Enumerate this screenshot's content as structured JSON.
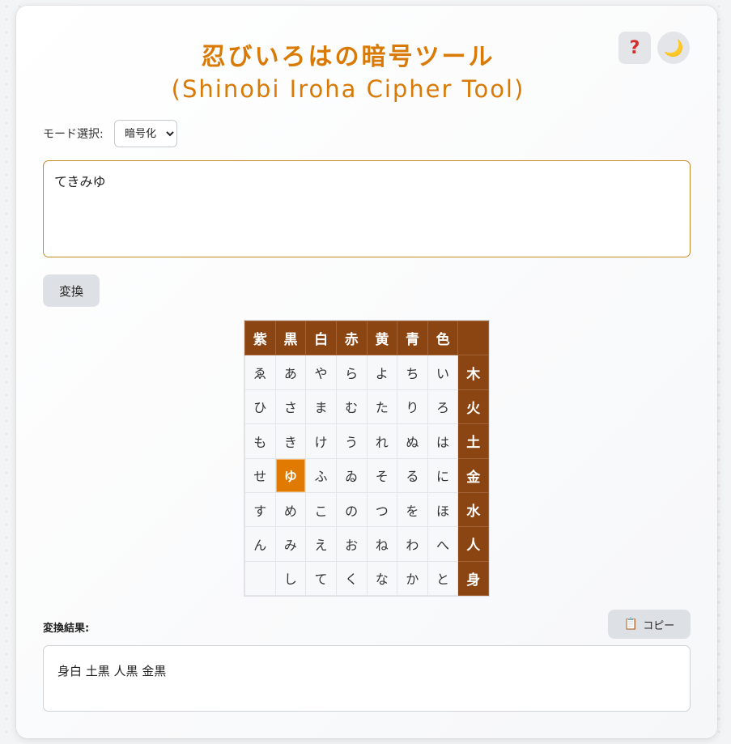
{
  "header": {
    "title": "忍びいろはの暗号ツール",
    "subtitle": "(Shinobi Iroha Cipher Tool)",
    "help_icon": "question-mark-icon",
    "theme_icon": "crescent-moon-icon",
    "help_glyph": "?",
    "theme_glyph": "🌙"
  },
  "controls": {
    "mode_label": "モード選択:",
    "mode_selected": "暗号化",
    "input_value": "てきみゆ",
    "convert_label": "変換"
  },
  "table": {
    "column_headers": [
      "紫",
      "黒",
      "白",
      "赤",
      "黄",
      "青",
      "色"
    ],
    "row_headers": [
      "木",
      "火",
      "土",
      "金",
      "水",
      "人",
      "身"
    ],
    "rows": [
      [
        "ゑ",
        "あ",
        "や",
        "ら",
        "よ",
        "ち",
        "い"
      ],
      [
        "ひ",
        "さ",
        "ま",
        "む",
        "た",
        "り",
        "ろ"
      ],
      [
        "も",
        "き",
        "け",
        "う",
        "れ",
        "ぬ",
        "は"
      ],
      [
        "せ",
        "ゆ",
        "ふ",
        "ゐ",
        "そ",
        "る",
        "に"
      ],
      [
        "す",
        "め",
        "こ",
        "の",
        "つ",
        "を",
        "ほ"
      ],
      [
        "ん",
        "み",
        "え",
        "お",
        "ね",
        "わ",
        "へ"
      ],
      [
        "",
        "し",
        "て",
        "く",
        "な",
        "か",
        "と"
      ]
    ],
    "highlighted_cell": "ゆ"
  },
  "result": {
    "label": "変換結果:",
    "copy_label": "コピー",
    "copy_icon": "clipboard-icon",
    "output": "身白 土黒 人黒 金黒"
  },
  "colors": {
    "accent": "#d97a06",
    "header_cell": "#8b4513",
    "highlight_cell": "#e07a00"
  }
}
